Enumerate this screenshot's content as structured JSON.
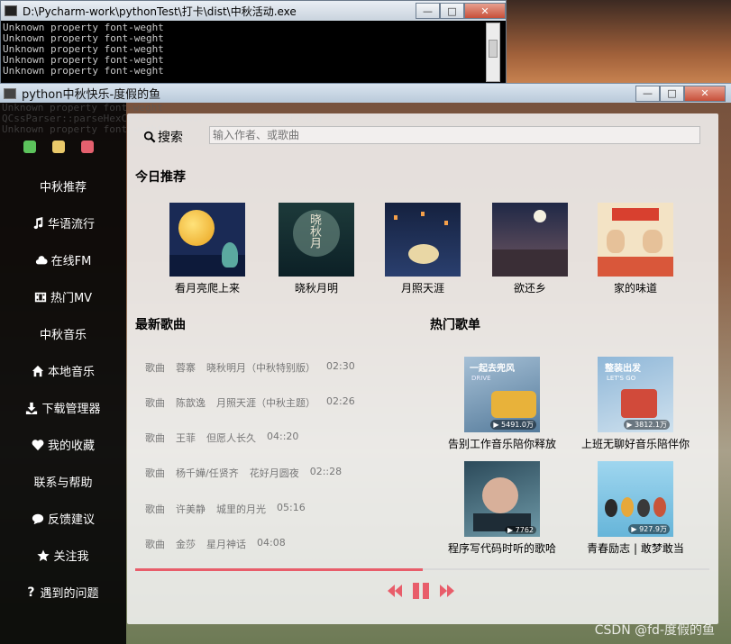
{
  "console": {
    "title": "D:\\Pycharm-work\\pythonTest\\打卡\\dist\\中秋活动.exe",
    "lines": [
      "Unknown property font-weght",
      "Unknown property font-weght",
      "Unknown property font-weght",
      "Unknown property font-weght",
      "Unknown property font-weght"
    ],
    "min": "—",
    "max": "□",
    "close": "✕"
  },
  "app": {
    "title": "python中秋快乐-度假的鱼",
    "ghost_lines": [
      "Unknown property font-weght",
      "QCssParser::parseHexColor: Unknown color name '#f6f6f7'",
      "Unknown property font-weght"
    ],
    "min": "—",
    "max": "□",
    "close": "✕"
  },
  "window_dots": {
    "colors": [
      "#5cc35c",
      "#e9c96a",
      "#e4606e"
    ]
  },
  "sidebar": {
    "items": [
      {
        "label": "中秋推荐",
        "icon": ""
      },
      {
        "label": "华语流行",
        "icon": "music-icon"
      },
      {
        "label": "在线FM",
        "icon": "cloud-icon"
      },
      {
        "label": "热门MV",
        "icon": "film-icon"
      },
      {
        "label": "中秋音乐",
        "icon": ""
      },
      {
        "label": "本地音乐",
        "icon": "home-icon"
      },
      {
        "label": "下载管理器",
        "icon": "download-icon"
      },
      {
        "label": "我的收藏",
        "icon": "heart-icon"
      },
      {
        "label": "联系与帮助",
        "icon": ""
      },
      {
        "label": "反馈建议",
        "icon": "chat-icon"
      },
      {
        "label": "关注我",
        "icon": "star-icon"
      },
      {
        "label": "遇到的问题",
        "icon": "question-icon"
      }
    ]
  },
  "search": {
    "label": "搜索",
    "placeholder": "输入作者、或歌曲"
  },
  "today": {
    "title": "今日推荐",
    "items": [
      {
        "caption": "看月亮爬上来"
      },
      {
        "caption": "晓秋月明"
      },
      {
        "caption": "月照天涯"
      },
      {
        "caption": "欲还乡"
      },
      {
        "caption": "家的味道"
      }
    ]
  },
  "latest": {
    "title": "最新歌曲",
    "songs": [
      {
        "type": "歌曲",
        "artist": "蓉寨",
        "name": "晓秋明月（中秋特别版）",
        "duration": "02:30"
      },
      {
        "type": "歌曲",
        "artist": "陈歆逸",
        "name": "月照天涯（中秋主题）",
        "duration": "02:26"
      },
      {
        "type": "歌曲",
        "artist": "王菲",
        "name": "但愿人长久",
        "duration": "04::20"
      },
      {
        "type": "歌曲",
        "artist": "杨千嬅/任贤齐",
        "name": "花好月圆夜",
        "duration": "02::28"
      },
      {
        "type": "歌曲",
        "artist": "许美静",
        "name": "城里的月光",
        "duration": "05:16"
      },
      {
        "type": "歌曲",
        "artist": "金莎",
        "name": "星月神话",
        "duration": "04:08"
      }
    ]
  },
  "hot": {
    "title": "热门歌单",
    "items": [
      {
        "caption": "告别工作音乐陪你释放",
        "cover_text": "一起去兜风",
        "cover_sub": "DRIVE",
        "plays": "▶ 5491.0万"
      },
      {
        "caption": "上班无聊好音乐陪伴你",
        "cover_text": "整装出发",
        "cover_sub": "LET'S GO",
        "plays": "▶ 3812.1万"
      },
      {
        "caption": "程序写代码时听的歌哈",
        "cover_text": "",
        "cover_sub": "",
        "plays": "▶ 7762"
      },
      {
        "caption": "青春励志 | 敢梦敢当",
        "cover_text": "",
        "cover_sub": "",
        "plays": "▶ 927.9万"
      }
    ]
  },
  "player": {
    "progress": 0.5,
    "accent": "#e85d6a"
  },
  "watermark": "CSDN @fd-度假的鱼"
}
